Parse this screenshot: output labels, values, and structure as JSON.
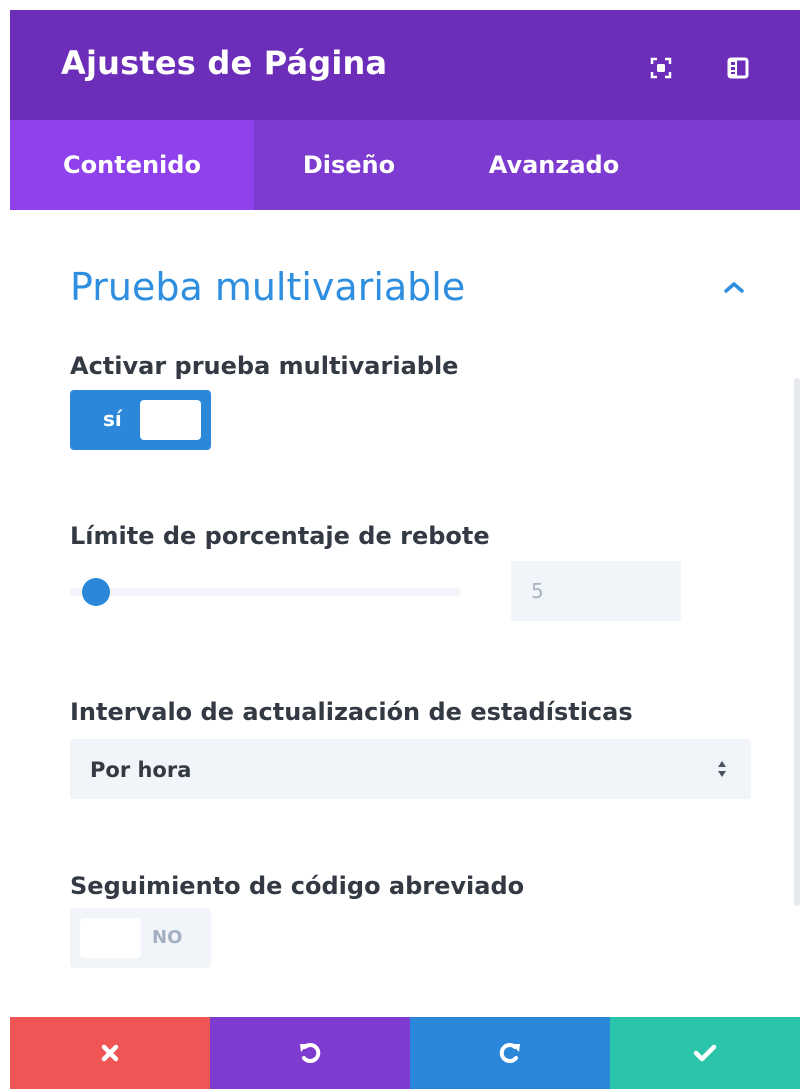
{
  "header": {
    "title": "Ajustes de Página",
    "icons": [
      "expand-icon",
      "sidebar-icon"
    ],
    "bg_color": "#6c2eb9"
  },
  "tabs": [
    {
      "label": "Contenido",
      "active": true
    },
    {
      "label": "Diseño",
      "active": false
    },
    {
      "label": "Avanzado",
      "active": false
    }
  ],
  "section": {
    "title": "Prueba multivariable",
    "expanded": true,
    "title_color": "#2e8ee0"
  },
  "fields": {
    "ab_testing": {
      "label": "Activar prueba multivariable",
      "state": "on",
      "toggle_text": "sí"
    },
    "bounce_limit": {
      "label": "Límite de porcentaje de rebote",
      "value": "5",
      "slider_fraction": 0.05
    },
    "stats_interval": {
      "label": "Intervalo de actualización de estadísticas",
      "selected": "Por hora"
    },
    "shortcode_tracking": {
      "label": "Seguimiento de código abreviado",
      "state": "off",
      "toggle_text": "NO"
    }
  },
  "footer": {
    "buttons": [
      {
        "name": "cancel",
        "icon": "close-icon",
        "color": "#ef5555"
      },
      {
        "name": "undo",
        "icon": "undo-icon",
        "color": "#7e3bd0"
      },
      {
        "name": "redo",
        "icon": "redo-icon",
        "color": "#2b87da"
      },
      {
        "name": "save",
        "icon": "check-icon",
        "color": "#29c4a9"
      }
    ]
  }
}
